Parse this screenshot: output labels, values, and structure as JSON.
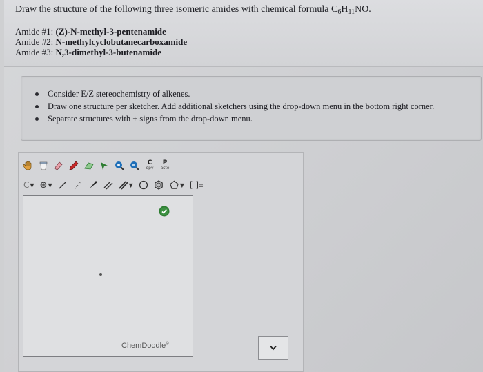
{
  "question": {
    "title_pre": "Draw the structure of the following three isomeric amides with chemical formula C",
    "sub_c": "6",
    "title_h": "H",
    "sub_h": "11",
    "title_post": "NO."
  },
  "amides": [
    {
      "label": "Amide #1:",
      "name": "(Z)-N-methyl-3-pentenamide"
    },
    {
      "label": "Amide #2:",
      "name": "N-methylcyclobutanecarboxamide"
    },
    {
      "label": "Amide #3:",
      "name": "N,3-dimethyl-3-butenamide"
    }
  ],
  "instructions": [
    "Consider E/Z stereochemistry of alkenes.",
    "Draw one structure per sketcher. Add additional sketchers using the drop-down menu in the bottom right corner.",
    "Separate structures with + signs from the drop-down menu."
  ],
  "toolbar": {
    "copy_letter": "C",
    "copy_text": "opy",
    "paste_letter": "P",
    "paste_text": "aste",
    "element_label": "C",
    "bracket_label": "[ ]",
    "bracket_sup": "±"
  },
  "sketcher": {
    "brand": "ChemDoodle",
    "brand_mark": "®"
  },
  "colors": {
    "check": "#2e7d32",
    "pencil_red": "#c62828",
    "eraser_pink": "#e8a0a8",
    "lasso_green": "#2e7d32",
    "zoom_blue": "#1e6fb8"
  }
}
